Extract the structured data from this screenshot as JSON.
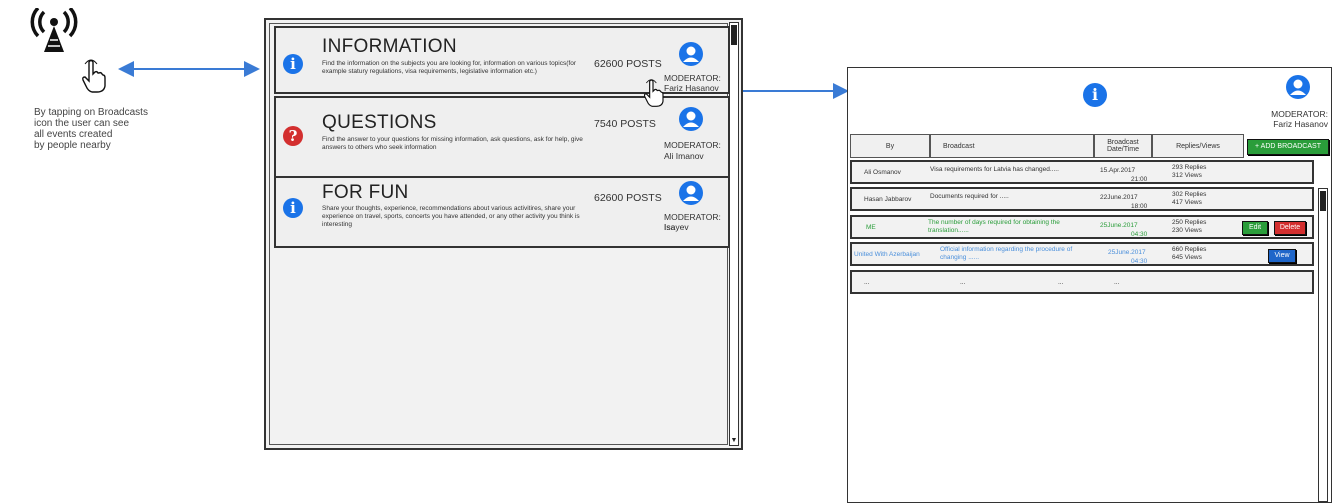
{
  "annotation": {
    "lines": [
      "By tapping on Broadcasts",
      "icon the user can see",
      "all events created",
      "by people nearby"
    ]
  },
  "categories": [
    {
      "title": "INFORMATION",
      "description": "Find the information on the subjects you are looking for, information on various topics(for example statury regulations, visa requirements, legislative information etc.)",
      "posts": "62600 POSTS",
      "moderator_label": "MODERATOR:",
      "moderator_name": "Fariz Hasanov",
      "icon": "info-icon",
      "icon_color": "#1a73e8"
    },
    {
      "title": "QUESTIONS",
      "description": "Find the answer to your questions for missing information, ask questions, ask for help, give answers to others who seek information",
      "posts": "7540 POSTS",
      "moderator_label": "MODERATOR:",
      "moderator_name": "Ali Imanov",
      "icon": "question-icon",
      "icon_color": "#d32f2f"
    },
    {
      "title": "FOR FUN",
      "description": "Share your thoughts, experience, recommendations about various activitires, share your experience on travel, sports, concerts you have attended, or any other activity you think is interesting",
      "posts": "62600 POSTS",
      "moderator_label": "MODERATOR: Isa",
      "moderator_name": "Isayev",
      "icon": "info-icon",
      "icon_color": "#1a73e8"
    }
  ],
  "detail": {
    "moderator_label": "MODERATOR:",
    "moderator_name": "Fariz Hasanov",
    "columns": {
      "by": "By",
      "broadcast": "Broadcast",
      "datetime_1": "Broadcast",
      "datetime_2": "Date/Time",
      "replies": "Replies/Views"
    },
    "add_button": "+ ADD BROADCAST",
    "rows": [
      {
        "by": "Ali Osmanov",
        "text": "Visa requirements for Latvia has changed.....",
        "date": "15.Apr.2017",
        "time": "21:00",
        "replies": "293 Replies",
        "views": "312  Views"
      },
      {
        "by": "Hasan Jabbarov",
        "text": "Documents required for .....",
        "date": "22June.2017",
        "time": "18:00",
        "replies": "302 Replies",
        "views": "417  Views"
      },
      {
        "by": "ME",
        "text": "The number of days required for obtaining the translation......",
        "date": "25June.2017",
        "time": "04:30",
        "replies": "250 Replies",
        "views": "230  Views",
        "edit": "Edit",
        "delete": "Delete"
      },
      {
        "by": "United With Azerbaijan",
        "text": "Official information regarding the procedure of changing ......",
        "date": "25June.2017",
        "time": "04:30",
        "replies": "660 Replies",
        "views": "645  Views",
        "view": "View"
      },
      {
        "c1": "...",
        "c2": "...",
        "c3": "...",
        "c4": "..."
      }
    ],
    "colors": {
      "green": "#2a9d3a",
      "blue": "#4a8fdb",
      "red": "#d32f2f",
      "button_blue": "#1f66c9"
    }
  }
}
